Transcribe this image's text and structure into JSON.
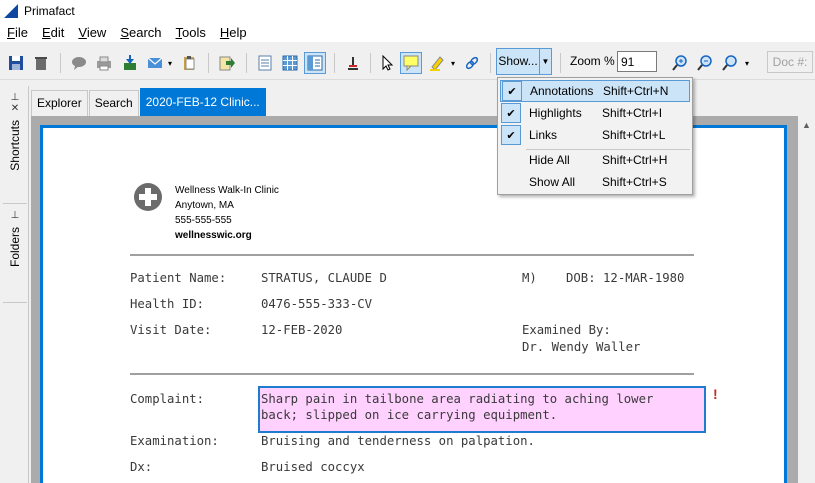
{
  "window": {
    "title": "Primafact"
  },
  "menu": [
    {
      "label": "File",
      "key": "F",
      "rest": "ile"
    },
    {
      "label": "Edit",
      "key": "E",
      "rest": "dit"
    },
    {
      "label": "View",
      "key": "V",
      "rest": "iew"
    },
    {
      "label": "Search",
      "key": "S",
      "rest": "earch"
    },
    {
      "label": "Tools",
      "key": "T",
      "rest": "ools"
    },
    {
      "label": "Help",
      "key": "H",
      "rest": "elp"
    }
  ],
  "toolbar": {
    "show_label": "Show...",
    "zoom_label": "Zoom % :",
    "zoom_value": "91",
    "doc_label": "Doc #:"
  },
  "sidebar": {
    "shortcuts": "Shortcuts",
    "folders": "Folders"
  },
  "tabs": [
    "Explorer",
    "Search",
    "2020-FEB-12 Clinic..."
  ],
  "show_menu": [
    {
      "label": "Annotations",
      "shortcut": "Shift+Ctrl+N",
      "checked": true
    },
    {
      "label": "Highlights",
      "shortcut": "Shift+Ctrl+I",
      "checked": true
    },
    {
      "label": "Links",
      "shortcut": "Shift+Ctrl+L",
      "checked": true
    },
    {
      "label": "Hide All",
      "shortcut": "Shift+Ctrl+H",
      "checked": false
    },
    {
      "label": "Show All",
      "shortcut": "Shift+Ctrl+S",
      "checked": false
    }
  ],
  "document": {
    "clinic_name": "Wellness Walk-In Clinic",
    "clinic_city": "Anytown, MA",
    "clinic_phone": "555-555-555",
    "clinic_web": "wellnesswic.org",
    "patient_label": "Patient Name:",
    "patient_value": "STRATUS, CLAUDE D",
    "sex": "M)",
    "dob": "DOB: 12-MAR-1980",
    "health_label": "Health ID:",
    "health_value": "0476-555-333-CV",
    "visit_label": "Visit Date:",
    "visit_value": "12-FEB-2020",
    "examined_label": "Examined By:",
    "examined_value": "Dr. Wendy Waller",
    "complaint_label": "Complaint:",
    "complaint_line1": "Sharp pain in tailbone area radiating to aching lower",
    "complaint_line2": "back; slipped on ice carrying equipment.",
    "exam_label": "Examination:",
    "exam_value": "Bruising and tenderness on palpation.",
    "dx_label": "Dx:",
    "dx_value": "Bruised coccyx",
    "annotation_marker": "!"
  }
}
